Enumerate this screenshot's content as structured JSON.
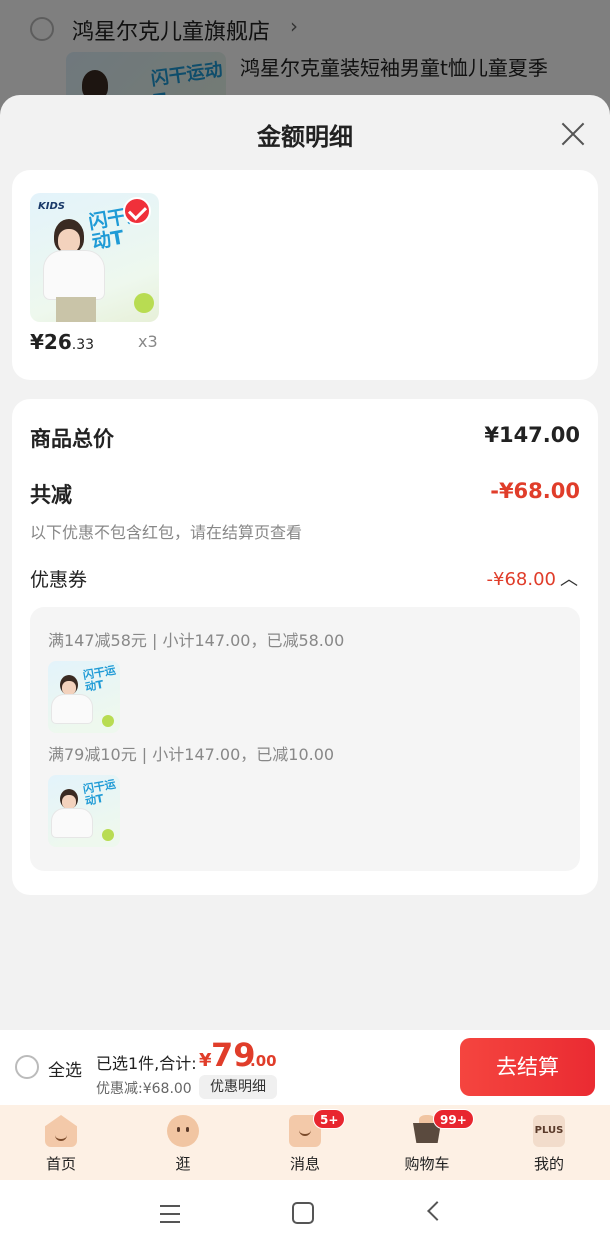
{
  "background_store": {
    "store_name": "鸿星尔克儿童旗舰店",
    "chevron": "›",
    "product_title": "鸿星尔克童装短袖男童t恤儿童夏季"
  },
  "sheet": {
    "title": "金额明细"
  },
  "item": {
    "price_symbol": "¥",
    "price_int": "26",
    "price_dec": ".33",
    "quantity": "x3",
    "image_slogan": "闪干运动T",
    "image_brand": "KIDS"
  },
  "breakdown": {
    "total_label": "商品总价",
    "total_value": "¥147.00",
    "reduce_label": "共减",
    "reduce_value": "-¥68.00",
    "note": "以下优惠不包含红包，请在结算页查看",
    "coupon_label": "优惠券",
    "coupon_value": "-¥68.00",
    "coupon_chevron": "︿",
    "coupons": [
      {
        "text": "满147减58元 | 小计147.00，已减58.00"
      },
      {
        "text": "满79减10元 | 小计147.00，已减10.00"
      }
    ]
  },
  "checkout": {
    "select_all": "全选",
    "summary": "已选1件,合计:",
    "total_symbol": "¥",
    "total_int": "79",
    "total_dec": ".00",
    "discount": "优惠减:¥68.00",
    "detail_button": "优惠明细",
    "checkout_button": "去结算"
  },
  "tabbar": {
    "tabs": [
      {
        "label": "首页",
        "icon": "home-icon",
        "badge": ""
      },
      {
        "label": "逛",
        "icon": "browse-face-icon",
        "badge": ""
      },
      {
        "label": "消息",
        "icon": "message-icon",
        "badge": "5+"
      },
      {
        "label": "购物车",
        "icon": "cart-icon",
        "badge": "99+"
      },
      {
        "label": "我的",
        "icon": "plus-member-icon",
        "badge": "",
        "icon_text": "PLUS"
      }
    ]
  },
  "colors": {
    "accent_red": "#e03d2a",
    "checkout_button": "#ea2b32",
    "tabbar_bg": "#fdf0e4"
  }
}
